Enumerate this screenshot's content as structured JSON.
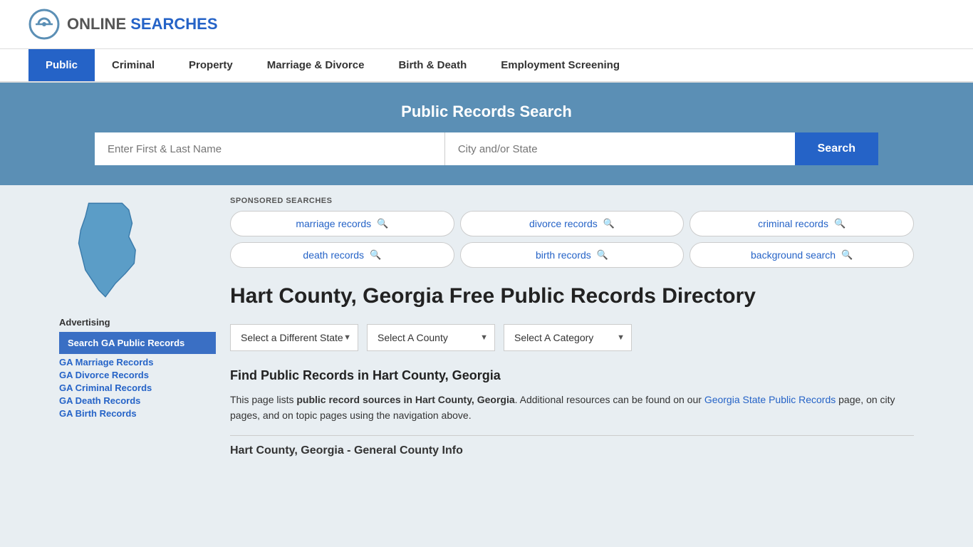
{
  "header": {
    "logo_text_online": "ONLINE",
    "logo_text_searches": "SEARCHES"
  },
  "nav": {
    "items": [
      {
        "label": "Public",
        "active": true
      },
      {
        "label": "Criminal",
        "active": false
      },
      {
        "label": "Property",
        "active": false
      },
      {
        "label": "Marriage & Divorce",
        "active": false
      },
      {
        "label": "Birth & Death",
        "active": false
      },
      {
        "label": "Employment Screening",
        "active": false
      }
    ]
  },
  "hero": {
    "title": "Public Records Search",
    "name_placeholder": "Enter First & Last Name",
    "location_placeholder": "City and/or State",
    "search_button": "Search"
  },
  "sponsored": {
    "label": "SPONSORED SEARCHES",
    "pills": [
      {
        "label": "marriage records"
      },
      {
        "label": "divorce records"
      },
      {
        "label": "criminal records"
      },
      {
        "label": "death records"
      },
      {
        "label": "birth records"
      },
      {
        "label": "background search"
      }
    ]
  },
  "page": {
    "title": "Hart County, Georgia Free Public Records Directory",
    "dropdowns": {
      "state": "Select a Different State",
      "county": "Select A County",
      "category": "Select A Category"
    },
    "find_title": "Find Public Records in Hart County, Georgia",
    "find_text_1": "This page lists ",
    "find_text_bold": "public record sources in Hart County, Georgia",
    "find_text_2": ". Additional resources can be found on our ",
    "find_link_text": "Georgia State Public Records",
    "find_text_3": " page, on city pages, and on topic pages using the navigation above.",
    "county_info_title": "Hart County, Georgia - General County Info"
  },
  "sidebar": {
    "advertising_label": "Advertising",
    "ad_block": "Search GA Public Records",
    "links": [
      "GA Marriage Records",
      "GA Divorce Records",
      "GA Criminal Records",
      "GA Death Records",
      "GA Birth Records"
    ]
  }
}
